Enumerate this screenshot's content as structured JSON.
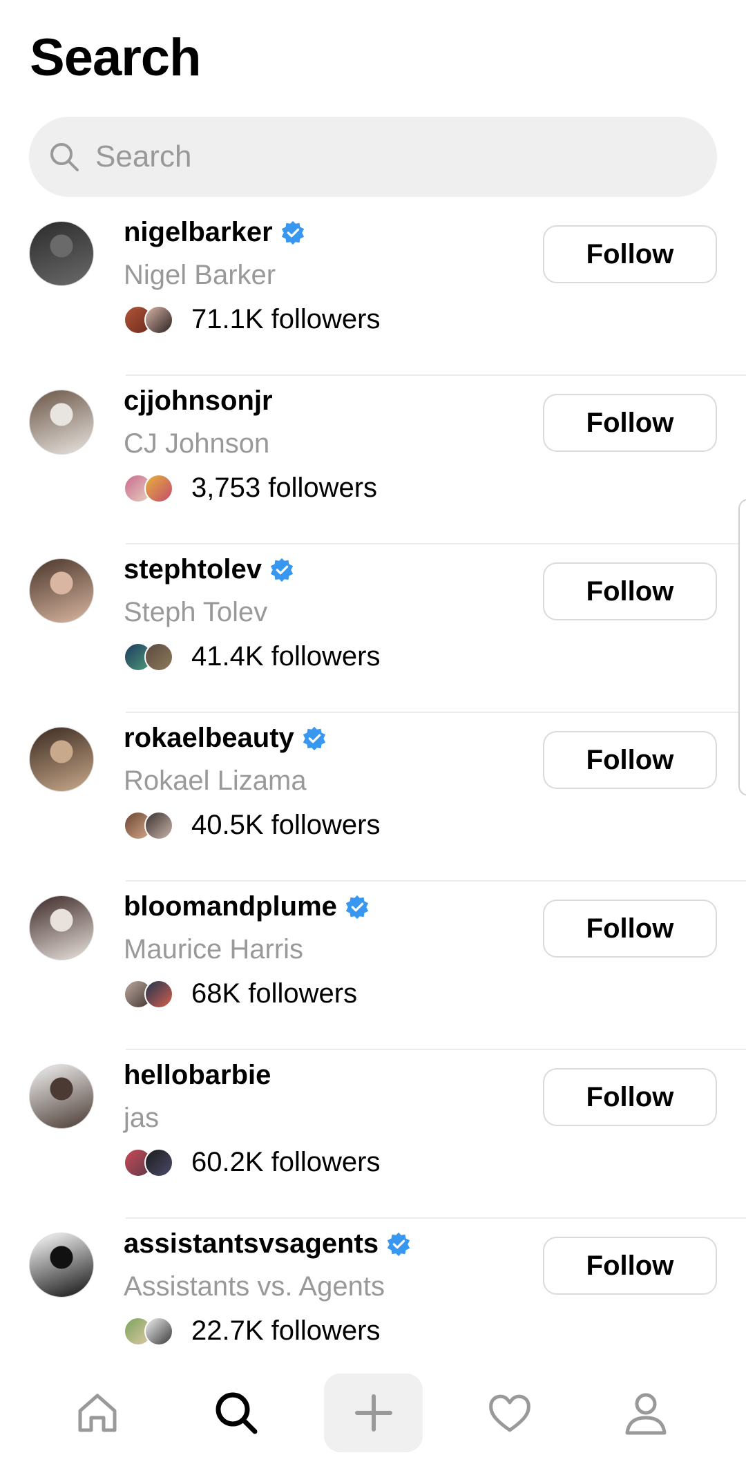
{
  "header": {
    "title": "Search"
  },
  "search": {
    "placeholder": "Search"
  },
  "results": [
    {
      "username": "nigelbarker",
      "verified": true,
      "full_name": "Nigel Barker",
      "followers": "71.1K followers",
      "button": "Follow",
      "avatar_colors": [
        "#2b2b2b",
        "#6a6a6a"
      ],
      "mini_colors": [
        [
          "#b0553a",
          "#6e2a1c"
        ],
        [
          "#d8b5a6",
          "#2a2020"
        ]
      ]
    },
    {
      "username": "cjjohnsonjr",
      "verified": false,
      "full_name": "CJ Johnson",
      "followers": "3,753 followers",
      "button": "Follow",
      "avatar_colors": [
        "#6b5647",
        "#e8e4df"
      ],
      "mini_colors": [
        [
          "#c96a8c",
          "#e7d3c2"
        ],
        [
          "#e8b23c",
          "#c24b6c"
        ]
      ]
    },
    {
      "username": "stephtolev",
      "verified": true,
      "full_name": "Steph Tolev",
      "followers": "41.4K followers",
      "button": "Follow",
      "avatar_colors": [
        "#4a362b",
        "#d9b6a1"
      ],
      "mini_colors": [
        [
          "#1e3a5f",
          "#4f9b77"
        ],
        [
          "#5b4a3e",
          "#8c7a5c"
        ]
      ]
    },
    {
      "username": "rokaelbeauty",
      "verified": true,
      "full_name": "Rokael Lizama",
      "followers": "40.5K followers",
      "button": "Follow",
      "avatar_colors": [
        "#3a2a20",
        "#c9a98b"
      ],
      "mini_colors": [
        [
          "#6b4634",
          "#d7a98a"
        ],
        [
          "#3a3230",
          "#c9b4a7"
        ]
      ]
    },
    {
      "username": "bloomandplume",
      "verified": true,
      "full_name": "Maurice Harris",
      "followers": "68K followers",
      "button": "Follow",
      "avatar_colors": [
        "#3d2a28",
        "#e9e2dc"
      ],
      "mini_colors": [
        [
          "#bfa89b",
          "#3e3633"
        ],
        [
          "#1f3550",
          "#d35f4c"
        ]
      ]
    },
    {
      "username": "hellobarbie",
      "verified": false,
      "full_name": "jas",
      "followers": "60.2K followers",
      "button": "Follow",
      "avatar_colors": [
        "#f2f2f2",
        "#4a3a33"
      ],
      "mini_colors": [
        [
          "#c94a55",
          "#5e3a4a"
        ],
        [
          "#1c1c1c",
          "#4a4a6a"
        ]
      ]
    },
    {
      "username": "assistantsvsagents",
      "verified": true,
      "full_name": "Assistants vs. Agents",
      "followers": "22.7K followers",
      "button": "Follow",
      "avatar_colors": [
        "#ffffff",
        "#111111"
      ],
      "mini_colors": [
        [
          "#7aa35a",
          "#e0c9a8"
        ],
        [
          "#f0f0f0",
          "#3a3a3a"
        ]
      ]
    }
  ],
  "colors": {
    "verified": "#3897f0",
    "secondary_text": "#999999",
    "divider": "#ececec"
  },
  "nav": [
    "home-icon",
    "search-icon",
    "plus-icon",
    "heart-icon",
    "profile-icon"
  ]
}
